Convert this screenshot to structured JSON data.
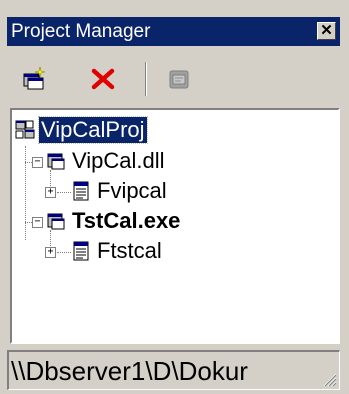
{
  "window": {
    "title": "Project Manager",
    "close_symbol": "✕"
  },
  "toolbar": {
    "buttons": [
      {
        "icon": "new-project-icon"
      },
      {
        "icon": "delete-icon"
      },
      {
        "icon": "options-icon",
        "enabled": false
      }
    ]
  },
  "tree": {
    "nodes": [
      {
        "label": "VipCalProj",
        "selected": true,
        "level": 0,
        "icon": "project-group-icon"
      },
      {
        "label": "VipCal.dll",
        "level": 1,
        "expanded": true,
        "icon": "project-icon"
      },
      {
        "label": "Fvipcal",
        "level": 2,
        "expanded": false,
        "icon": "form-icon"
      },
      {
        "label": "TstCal.exe",
        "level": 1,
        "expanded": true,
        "bold": true,
        "icon": "project-icon"
      },
      {
        "label": "Ftstcal",
        "level": 2,
        "expanded": false,
        "icon": "form-icon"
      }
    ]
  },
  "statusbar": {
    "path": "\\\\Dbserver1\\D\\Dokur"
  },
  "colors": {
    "title_bg": "#0a246a",
    "selection_bg": "#0a246a",
    "face": "#d4d0c8",
    "delete_red": "#e00000"
  }
}
